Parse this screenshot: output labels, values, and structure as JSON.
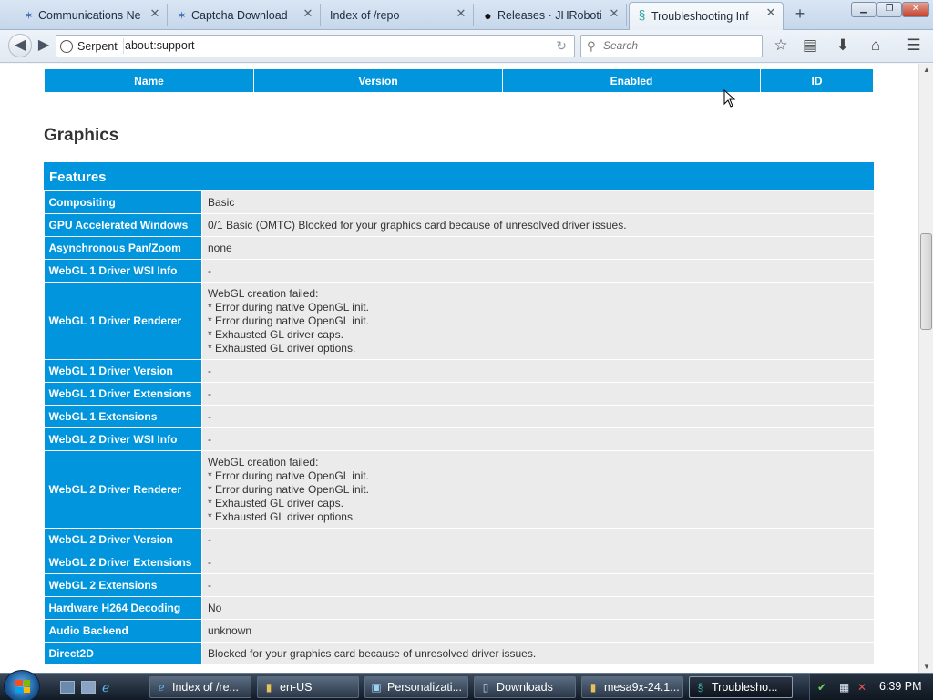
{
  "browser": {
    "tabs": [
      {
        "label": "Communications Ne",
        "icon": "bugzilla-icon",
        "active": false
      },
      {
        "label": "Captcha Download",
        "icon": "bugzilla-icon",
        "active": false
      },
      {
        "label": "Index of /repo",
        "icon": "none",
        "active": false
      },
      {
        "label": "Releases · JHRobotic",
        "icon": "github-icon",
        "active": false
      },
      {
        "label": "Troubleshooting Inf",
        "icon": "serpent-icon",
        "active": true
      }
    ],
    "identity_label": "Serpent",
    "url": "about:support",
    "search_placeholder": "Search"
  },
  "page": {
    "addons_headers": [
      "Name",
      "Version",
      "Enabled",
      "ID"
    ],
    "graphics_heading": "Graphics",
    "features_heading": "Features",
    "features": [
      {
        "key": "Compositing",
        "value": [
          "Basic"
        ]
      },
      {
        "key": "GPU Accelerated Windows",
        "value": [
          "0/1 Basic (OMTC) Blocked for your graphics card because of unresolved driver issues."
        ]
      },
      {
        "key": "Asynchronous Pan/Zoom",
        "value": [
          "none"
        ]
      },
      {
        "key": "WebGL 1 Driver WSI Info",
        "value": [
          "-"
        ]
      },
      {
        "key": "WebGL 1 Driver Renderer",
        "value": [
          "WebGL creation failed:",
          "* Error during native OpenGL init.",
          "* Error during native OpenGL init.",
          "* Exhausted GL driver caps.",
          "* Exhausted GL driver options."
        ]
      },
      {
        "key": "WebGL 1 Driver Version",
        "value": [
          "-"
        ]
      },
      {
        "key": "WebGL 1 Driver Extensions",
        "value": [
          "-"
        ]
      },
      {
        "key": "WebGL 1 Extensions",
        "value": [
          "-"
        ]
      },
      {
        "key": "WebGL 2 Driver WSI Info",
        "value": [
          "-"
        ]
      },
      {
        "key": "WebGL 2 Driver Renderer",
        "value": [
          "WebGL creation failed:",
          "* Error during native OpenGL init.",
          "* Error during native OpenGL init.",
          "* Exhausted GL driver caps.",
          "* Exhausted GL driver options."
        ]
      },
      {
        "key": "WebGL 2 Driver Version",
        "value": [
          "-"
        ]
      },
      {
        "key": "WebGL 2 Driver Extensions",
        "value": [
          "-"
        ]
      },
      {
        "key": "WebGL 2 Extensions",
        "value": [
          "-"
        ]
      },
      {
        "key": "Hardware H264 Decoding",
        "value": [
          "No"
        ]
      },
      {
        "key": "Audio Backend",
        "value": [
          "unknown"
        ]
      },
      {
        "key": "Direct2D",
        "value": [
          "Blocked for your graphics card because of unresolved driver issues."
        ]
      }
    ]
  },
  "taskbar": {
    "items": [
      {
        "label": "Index of /re...",
        "icon": "ie-icon",
        "active": false
      },
      {
        "label": "en-US",
        "icon": "folder-icon",
        "active": false
      },
      {
        "label": "Personalizati...",
        "icon": "personalization-icon",
        "active": false
      },
      {
        "label": "Downloads",
        "icon": "downloads-icon",
        "active": false
      },
      {
        "label": "mesa9x-24.1...",
        "icon": "folder-icon",
        "active": false
      },
      {
        "label": "Troublesho...",
        "icon": "serpent-icon",
        "active": true
      }
    ],
    "clock": "6:39 PM"
  },
  "colors": {
    "accent": "#0095dd",
    "value_bg": "#ebebeb"
  }
}
